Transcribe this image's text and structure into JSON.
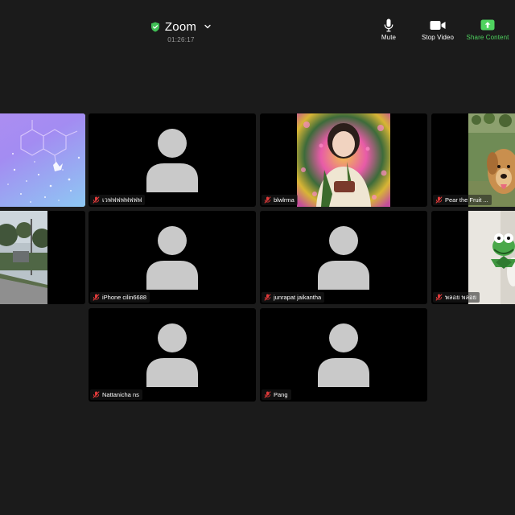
{
  "header": {
    "title": "Zoom",
    "timer": "01:26:17"
  },
  "toolbar": {
    "mute_label": "Mute",
    "stop_video_label": "Stop Video",
    "share_label": "Share Content"
  },
  "participants": [
    {
      "name": ""
    },
    {
      "name": "เวฟฟฟฟฟฟฟฟ"
    },
    {
      "name": "blwlrma"
    },
    {
      "name": "Pear the Fruit ..."
    },
    {
      "name": ""
    },
    {
      "name": "iPhone cilin6688"
    },
    {
      "name": "junrapat jaikantha"
    },
    {
      "name": "พลอย พลอย"
    },
    {
      "name": "Nattanicha ns"
    },
    {
      "name": "Pang"
    }
  ],
  "colors": {
    "background": "#1b1b1b",
    "tile": "#000000",
    "active_border": "#7ddc6a",
    "share_green": "#4fd35f",
    "avatar": "#c9c9c9",
    "muted_red": "#e03a3a"
  }
}
